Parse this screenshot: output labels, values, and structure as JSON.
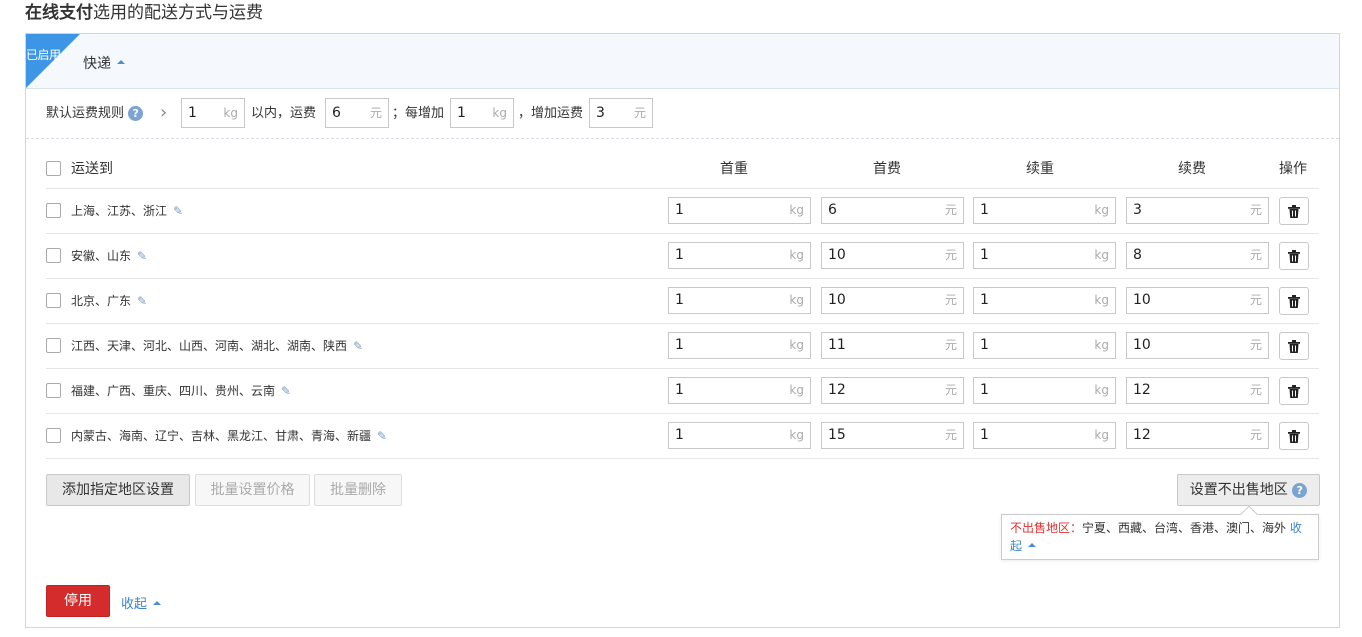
{
  "page_title": {
    "bold": "在线支付",
    "rest": "选用的配送方式与运费"
  },
  "method": {
    "badge": "已启用",
    "name": "快递"
  },
  "default_rule": {
    "label": "默认运费规则",
    "help": "?",
    "first_weight": "1",
    "first_weight_unit": "kg",
    "within_text": "以内，运费",
    "first_fee": "6",
    "first_fee_unit": "元",
    "each_add_text": "；每增加",
    "add_weight": "1",
    "add_weight_unit": "kg",
    "add_fee_text": "，增加运费",
    "add_fee": "3",
    "add_fee_unit": "元"
  },
  "table": {
    "headers": {
      "ship_to": "运送到",
      "first_weight": "首重",
      "first_fee": "首费",
      "add_weight": "续重",
      "add_fee": "续费",
      "ops": "操作"
    },
    "rows": [
      {
        "regions": "上海、江苏、浙江",
        "first_weight": "1",
        "first_fee": "6",
        "add_weight": "1",
        "add_fee": "3"
      },
      {
        "regions": "安徽、山东",
        "first_weight": "1",
        "first_fee": "10",
        "add_weight": "1",
        "add_fee": "8"
      },
      {
        "regions": "北京、广东",
        "first_weight": "1",
        "first_fee": "10",
        "add_weight": "1",
        "add_fee": "10"
      },
      {
        "regions": "江西、天津、河北、山西、河南、湖北、湖南、陕西",
        "first_weight": "1",
        "first_fee": "11",
        "add_weight": "1",
        "add_fee": "10"
      },
      {
        "regions": "福建、广西、重庆、四川、贵州、云南",
        "first_weight": "1",
        "first_fee": "12",
        "add_weight": "1",
        "add_fee": "12"
      },
      {
        "regions": "内蒙古、海南、辽宁、吉林、黑龙江、甘肃、青海、新疆",
        "first_weight": "1",
        "first_fee": "15",
        "add_weight": "1",
        "add_fee": "12"
      }
    ],
    "units": {
      "weight": "kg",
      "fee": "元"
    }
  },
  "actions": {
    "add_region": "添加指定地区设置",
    "batch_price": "批量设置价格",
    "batch_delete": "批量删除",
    "no_sale": "设置不出售地区"
  },
  "no_sale_tip": {
    "label": "不出售地区：",
    "regions": "宁夏、西藏、台湾、香港、澳门、海外",
    "collapse_a": "收",
    "collapse_b": "起"
  },
  "footer": {
    "disable": "停用",
    "collapse": "收起"
  },
  "colors": {
    "accent_blue": "#3d95e6",
    "danger_red": "#d42c2c",
    "link_blue": "#3c84c6"
  }
}
